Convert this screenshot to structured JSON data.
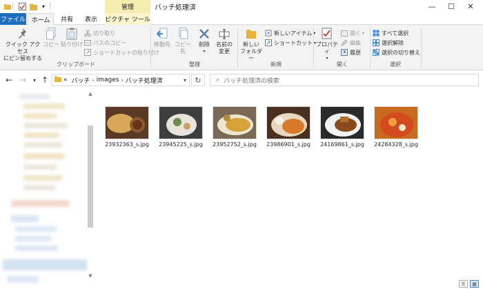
{
  "titlebar": {
    "context_tab_header": "管理",
    "window_title": "バッチ処理済",
    "minimize": "—",
    "maximize": "☐",
    "close": "✕"
  },
  "tabs": {
    "file": "ファイル",
    "home": "ホーム",
    "share": "共有",
    "view": "表示",
    "picture_tools": "ピクチャ ツール"
  },
  "ribbon": {
    "clipboard": {
      "pin_quick_access": "クイック アクセス",
      "pin_quick_access_2": "にピン留めする",
      "copy": "コピー",
      "paste": "貼り付け",
      "cut": "切り取り",
      "copy_path": "パスのコピー",
      "paste_shortcut": "ショートカットの貼り付け",
      "group_label": "クリップボード"
    },
    "organize": {
      "move_to": "移動先",
      "copy_to": "コピー先",
      "delete": "削除",
      "rename": "名前の",
      "rename_2": "変更",
      "group_label": "整理"
    },
    "new": {
      "new_folder": "新しい",
      "new_folder_2": "フォルダー",
      "new_item": "新しいアイテム",
      "shortcut": "ショートカット",
      "group_label": "新規"
    },
    "open": {
      "properties": "プロパティ",
      "open": "開く",
      "edit": "編集",
      "history": "履歴",
      "group_label": "開く"
    },
    "select": {
      "select_all": "すべて選択",
      "select_none": "選択解除",
      "invert": "選択の切り替え",
      "group_label": "選択"
    }
  },
  "address": {
    "overflow": "«",
    "seg1": "バッチ",
    "seg2": "images",
    "seg3": "バッチ処理済",
    "search_placeholder": "バッチ処理済の検索"
  },
  "files": [
    {
      "name": "23932363_s.jpg",
      "colors": [
        "#5a3a24",
        "#d9a75a",
        "#8c5a2e"
      ]
    },
    {
      "name": "23945225_s.jpg",
      "colors": [
        "#3e3e3e",
        "#e8e4dc",
        "#6f8a4c"
      ]
    },
    {
      "name": "23952752_s.jpg",
      "colors": [
        "#7a6a55",
        "#d6a23a",
        "#b58a3a"
      ]
    },
    {
      "name": "23986901_s.jpg",
      "colors": [
        "#4a3020",
        "#d97a2a",
        "#e8d8c0"
      ]
    },
    {
      "name": "24169861_s.jpg",
      "colors": [
        "#2a2a2a",
        "#f2f2f2",
        "#8a4a1e"
      ]
    },
    {
      "name": "24284328_s.jpg",
      "colors": [
        "#c86a20",
        "#d24a1e",
        "#f0a040"
      ]
    }
  ]
}
